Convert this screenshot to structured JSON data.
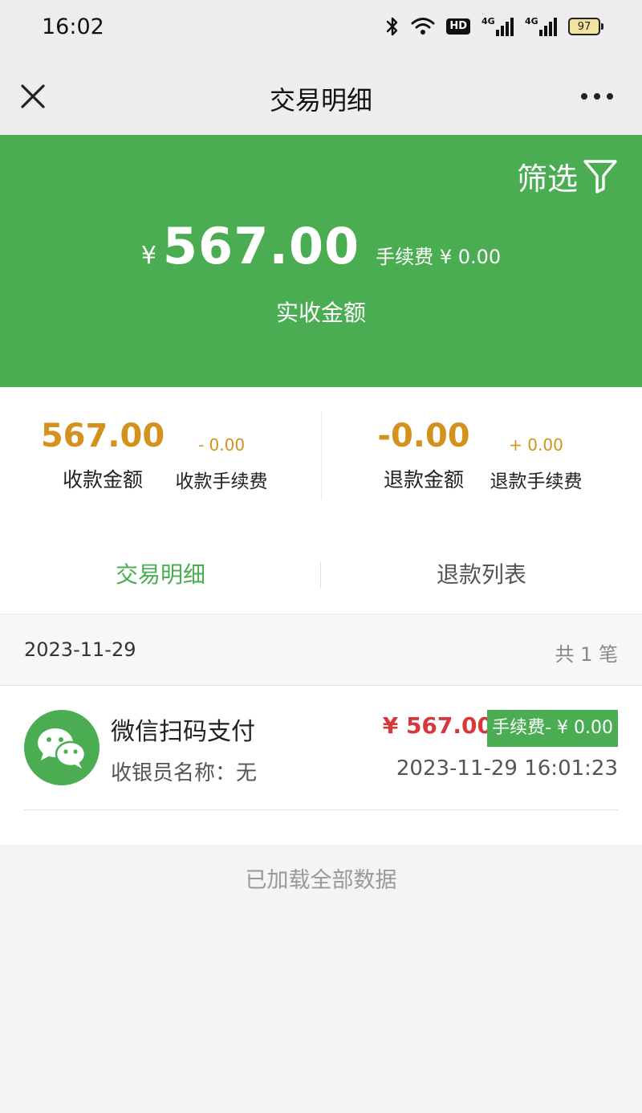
{
  "status_bar": {
    "time": "16:02",
    "bluetooth_icon": "bluetooth-icon",
    "wifi_icon": "wifi-icon",
    "hd_label": "HD",
    "signal1_label": "4G",
    "signal2_label": "4G",
    "battery": "97"
  },
  "nav": {
    "title": "交易明细",
    "close_icon": "close-icon",
    "more_icon": "more-icon"
  },
  "hero": {
    "filter_label": "筛选",
    "filter_icon": "filter-icon",
    "currency": "¥",
    "amount": "567.00",
    "fee_text": "手续费 ¥ 0.00",
    "caption": "实收金额",
    "bg_color": "#4aad52"
  },
  "summary": {
    "received_amount": "567.00",
    "received_label": "收款金额",
    "received_fee": "- 0.00",
    "received_fee_label": "收款手续费",
    "refund_amount": "-0.00",
    "refund_label": "退款金额",
    "refund_fee": "+ 0.00",
    "refund_fee_label": "退款手续费",
    "accent_color": "#d4911d"
  },
  "tabs": [
    {
      "label": "交易明细",
      "active": true
    },
    {
      "label": "退款列表",
      "active": false
    }
  ],
  "date_group": {
    "date": "2023-11-29",
    "count": "共 1 笔"
  },
  "transactions": [
    {
      "icon": "wechat-icon",
      "method": "微信扫码支付",
      "cashier": "收银员名称：无",
      "amount": "¥ 567.00",
      "fee": "手续费- ¥ 0.00",
      "time": "2023-11-29 16:01:23"
    }
  ],
  "footer": "已加载全部数据"
}
